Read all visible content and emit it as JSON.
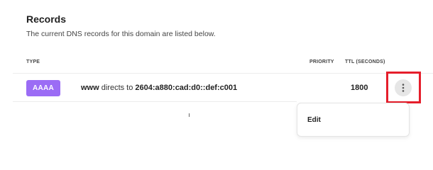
{
  "section": {
    "title": "Records",
    "subtitle": "The current DNS records for this domain are listed below."
  },
  "table": {
    "columns": {
      "type": "TYPE",
      "priority": "PRIORITY",
      "ttl": "TTL (SECONDS)"
    },
    "rows": [
      {
        "type": "AAAA",
        "host": "www",
        "connector": " directs to ",
        "value": "2604:a880:cad:d0::def:c001",
        "priority": "",
        "ttl": "1800"
      }
    ]
  },
  "row_actions": {
    "icon": "more-vertical-icon"
  },
  "menu": {
    "items": [
      {
        "label": "Edit"
      }
    ]
  },
  "colors": {
    "type_badge": "#9b6cf5",
    "highlight": "#e51e2b",
    "kebab_bg": "#e6e6e6"
  }
}
